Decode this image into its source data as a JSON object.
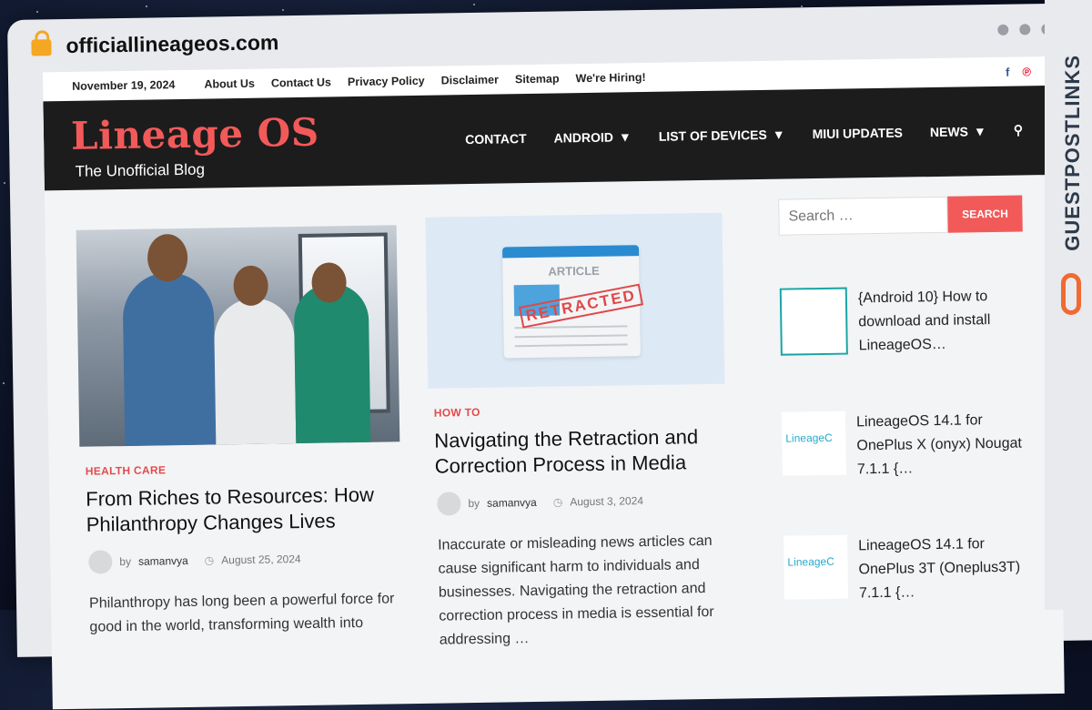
{
  "browser": {
    "url": "officiallineageos.com",
    "lock_icon": "lock-icon"
  },
  "topbar": {
    "date": "November 19, 2024",
    "links": [
      "About Us",
      "Contact Us",
      "Privacy Policy",
      "Disclaimer",
      "Sitemap",
      "We're Hiring!"
    ],
    "social": [
      "facebook-icon",
      "pinterest-icon"
    ]
  },
  "header": {
    "logo": "Lineage OS",
    "tagline": "The Unofficial Blog",
    "nav": [
      {
        "label": "CONTACT",
        "dropdown": false
      },
      {
        "label": "ANDROID",
        "dropdown": true
      },
      {
        "label": "LIST OF DEVICES",
        "dropdown": true
      },
      {
        "label": "MIUI UPDATES",
        "dropdown": false
      },
      {
        "label": "NEWS",
        "dropdown": true
      }
    ]
  },
  "posts": [
    {
      "category": "HEALTH CARE",
      "title": "From Riches to Resources: How Philanthropy Changes Lives",
      "by": "by",
      "author": "samanvya",
      "date": "August 25, 2024",
      "excerpt": "Philanthropy has long been a powerful force for good in the world, transforming wealth into"
    },
    {
      "category": "HOW TO",
      "title": "Navigating the Retraction and Correction Process in Media",
      "by": "by",
      "author": "samanvya",
      "date": "August 3, 2024",
      "excerpt": "Inaccurate or misleading news articles can cause significant harm to individuals and businesses. Navigating the retraction and correction process in media is essential for addressing …",
      "image_text": {
        "article": "ARTICLE",
        "stamp": "RETRACTED"
      }
    }
  ],
  "sidebar": {
    "search_placeholder": "Search …",
    "search_button": "SEARCH",
    "items": [
      {
        "title": "{Android 10} How to download and install LineageOS…"
      },
      {
        "title": "LineageOS 14.1 for OnePlus X (onyx) Nougat 7.1.1 {…"
      },
      {
        "title": "LineageOS 14.1 for OnePlus 3T (Oneplus3T) 7.1.1 {…"
      }
    ],
    "thumb_logo": "LineageC"
  },
  "watermark": {
    "text": "GUESTPOSTLINKS"
  }
}
